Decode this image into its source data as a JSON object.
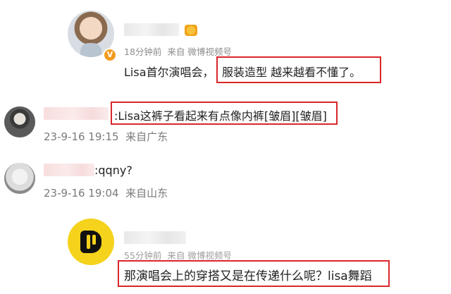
{
  "comments": [
    {
      "time": "18分钟前",
      "source": "来自 微博视频号",
      "text_prefix": "Lisa首尔演唱会，",
      "text_highlight": "服装造型 越来越看不懂了。",
      "badge_icon": "vip-v-icon"
    },
    {
      "text": ":Lisa这裤子看起来有点像内裤[皱眉][皱眉]",
      "date": "23-9-16 19:15",
      "location": "来自广东"
    },
    {
      "text": ":qqny?",
      "date": "23-9-16 19:04",
      "location": "来自山东"
    },
    {
      "time": "55分钟前",
      "source": "来自 微博视频号",
      "text": "那演唱会上的穿搭又是在传递什么呢？lisa舞蹈"
    }
  ],
  "colors": {
    "highlight_box": "#d9262b",
    "meta_text": "#8c8c8c",
    "badge": "#f39b1c"
  }
}
